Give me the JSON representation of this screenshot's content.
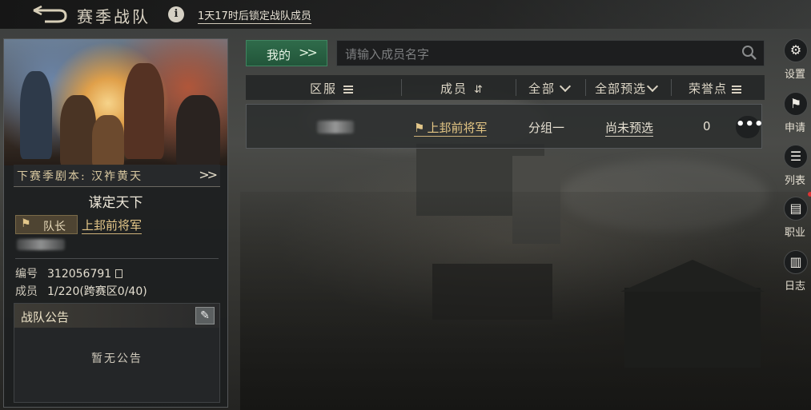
{
  "header": {
    "title": "赛季战队",
    "info_icon": "i",
    "lock_notice": "1天17时后锁定战队成员"
  },
  "team_card": {
    "next_season": "下赛季剧本: 汉祚黄天",
    "team_name": "谋定天下",
    "leader_badge": "队长",
    "leader_rank": "上邽前将军",
    "id_label": "编号",
    "id_value": "312056791",
    "members_label": "成员",
    "members_value": "1/220(跨赛区0/40)",
    "notice_title": "战队公告",
    "notice_empty": "暂无公告"
  },
  "toolbar": {
    "mine_label": "我的",
    "search_placeholder": "请输入成员名字"
  },
  "table": {
    "headers": {
      "server": "区服",
      "member": "成员",
      "group": "全部",
      "preselect": "全部预选",
      "honor": "荣誉点"
    },
    "rows": [
      {
        "rank": "上邽前将军",
        "group": "分组一",
        "preselect": "尚未预选",
        "honor": "0"
      }
    ]
  },
  "rail": {
    "settings": "设置",
    "apply": "申请",
    "list": "列表",
    "career": "职业",
    "log": "日志"
  },
  "colors": {
    "accent_green": "#2f6b4a",
    "gold_text": "#e6c886",
    "notify_dot": "#dd3333"
  }
}
